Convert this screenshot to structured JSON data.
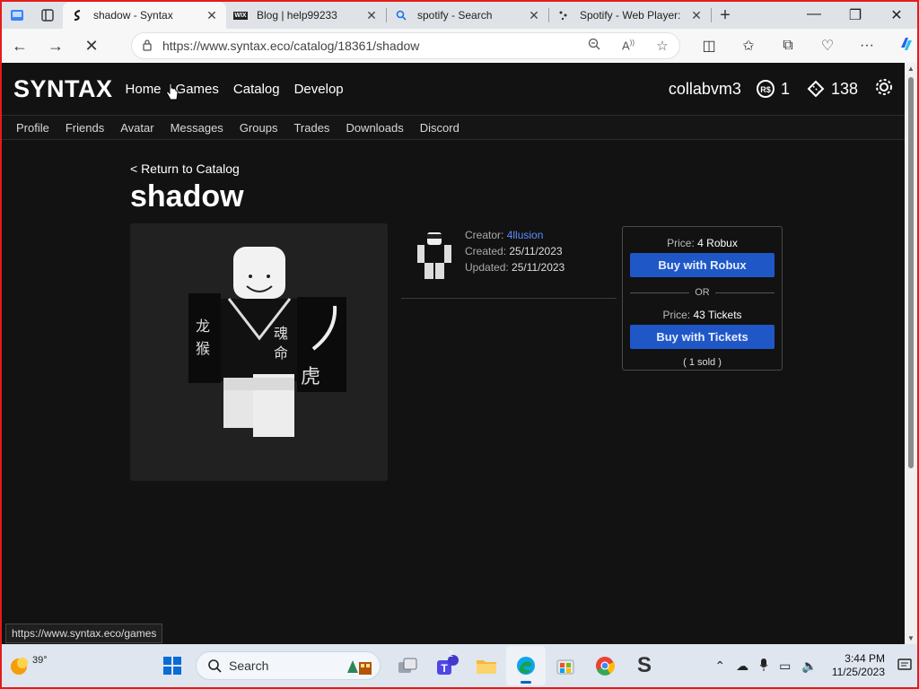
{
  "browser": {
    "tabs": [
      {
        "title": "shadow - Syntax",
        "active": true
      },
      {
        "title": "Blog | help99233",
        "active": false
      },
      {
        "title": "spotify - Search",
        "active": false
      },
      {
        "title": "Spotify - Web Player:",
        "active": false
      }
    ],
    "url": "https://www.syntax.eco/catalog/18361/shadow",
    "wix_favicon": "WIX"
  },
  "site": {
    "logo": "SYNTAX",
    "nav": [
      "Home",
      "Games",
      "Catalog",
      "Develop"
    ],
    "username": "collabvm3",
    "robux": "1",
    "tickets": "138",
    "subnav": [
      "Profile",
      "Friends",
      "Avatar",
      "Messages",
      "Groups",
      "Trades",
      "Downloads",
      "Discord"
    ]
  },
  "item": {
    "return_link": "< Return to Catalog",
    "title": "shadow",
    "creator_label": "Creator:",
    "creator": "4llusion",
    "created_label": "Created:",
    "created": "25/11/2023",
    "updated_label": "Updated:",
    "updated": "25/11/2023"
  },
  "purchase": {
    "robux_price_label": "Price:",
    "robux_price": "4 Robux",
    "buy_robux": "Buy with Robux",
    "or": "OR",
    "tickets_price_label": "Price:",
    "tickets_price": "43 Tickets",
    "buy_tickets": "Buy with Tickets",
    "sold": "( 1 sold )"
  },
  "status_url": "https://www.syntax.eco/games",
  "taskbar": {
    "temperature": "39°",
    "search_label": "Search",
    "teams_badge": "2",
    "time": "3:44 PM",
    "date": "11/25/2023"
  },
  "colors": {
    "page_bg": "#121212",
    "button_blue": "#1f57c7",
    "link_blue": "#5b8cff",
    "frame_red": "#e11d1d"
  }
}
